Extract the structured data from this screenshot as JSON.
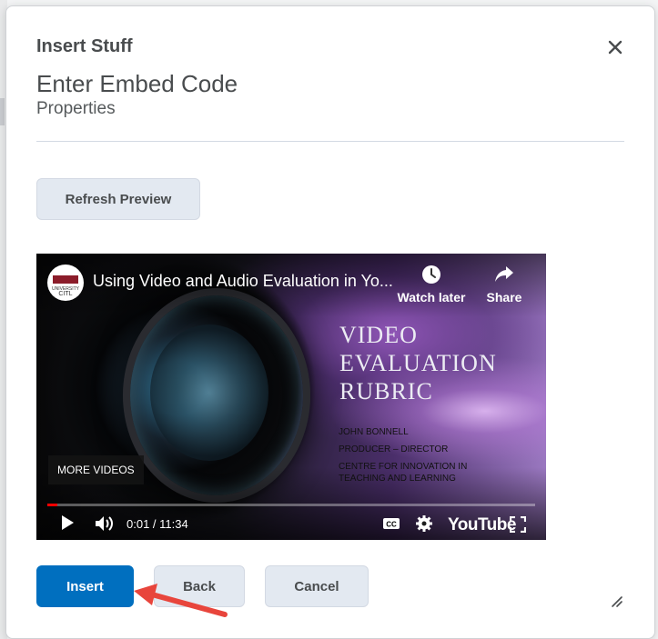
{
  "dialog": {
    "title": "Insert Stuff",
    "heading": "Enter Embed Code",
    "subheading": "Properties",
    "refresh_label": "Refresh Preview"
  },
  "video": {
    "channel_logo_text": "UNIVERSITY",
    "channel_logo_abbr": "CITL",
    "title": "Using Video and Audio Evaluation in Yo...",
    "watch_later_label": "Watch later",
    "share_label": "Share",
    "slide_title_lines": [
      "VIDEO",
      "EVALUATION",
      "RUBRIC"
    ],
    "credits": {
      "name": "JOHN BONNELL",
      "role": "PRODUCER – DIRECTOR",
      "org": "CENTRE FOR INNOVATION IN TEACHING AND LEARNING"
    },
    "more_videos_label": "MORE VIDEOS",
    "time_readout": "0:01 / 11:34",
    "progress_fraction": 0.02,
    "brand_label": "YouTube"
  },
  "footer": {
    "insert_label": "Insert",
    "back_label": "Back",
    "cancel_label": "Cancel"
  },
  "colors": {
    "primary": "#006fbf",
    "secondary_bg": "#e3e9f1",
    "annotation_arrow": "#e8453c",
    "progress": "#ff0000"
  },
  "icons": [
    "close-icon",
    "clock-icon",
    "share-arrow-icon",
    "play-icon",
    "volume-icon",
    "cc-icon",
    "gear-icon",
    "fullscreen-icon",
    "resize-grip-icon"
  ]
}
